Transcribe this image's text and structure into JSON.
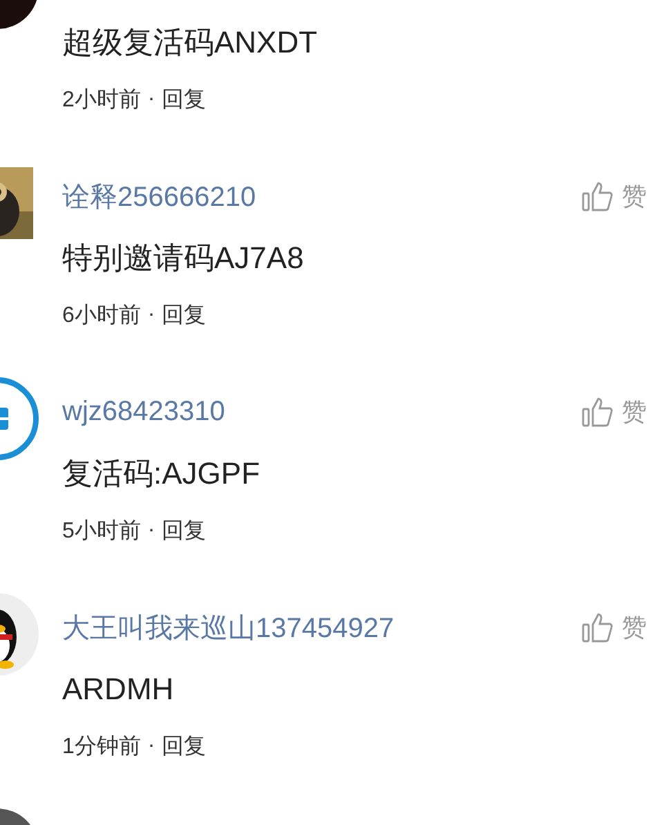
{
  "comments": [
    {
      "avatar": {
        "kind": "picture"
      },
      "body": "超级复活码ANXDT",
      "time": "2小时前",
      "separator": "·",
      "reply": "回复"
    },
    {
      "avatar": {
        "kind": "picture"
      },
      "username": "诠释256666210",
      "like": "赞",
      "body": "特别邀请码AJ7A8",
      "time": "6小时前",
      "separator": "·",
      "reply": "回复"
    },
    {
      "avatar": {
        "kind": "picture"
      },
      "username": "wjz68423310",
      "like": "赞",
      "body": "复活码:AJGPF",
      "time": "5小时前",
      "separator": "·",
      "reply": "回复"
    },
    {
      "avatar": {
        "kind": "picture"
      },
      "username": "大王叫我来巡山137454927",
      "like": "赞",
      "body": "ARDMH",
      "time": "1分钟前",
      "separator": "·",
      "reply": "回复"
    },
    {
      "avatar": {
        "kind": "picture"
      }
    }
  ]
}
